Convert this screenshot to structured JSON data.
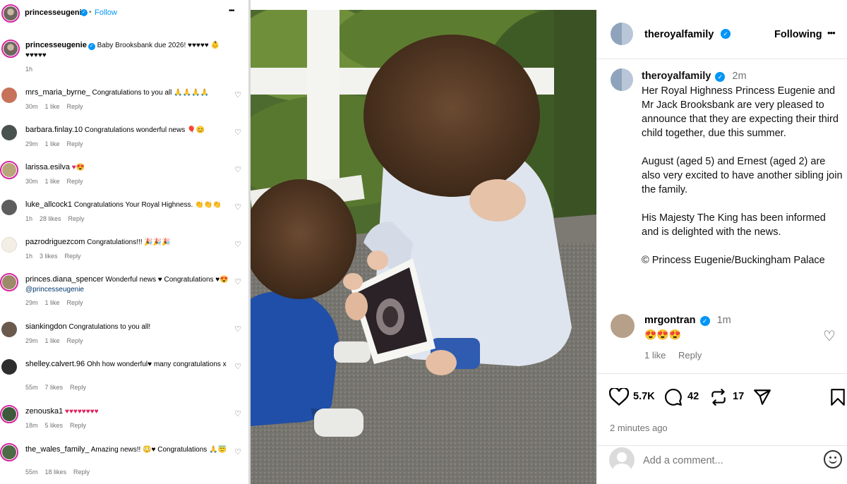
{
  "left_panel": {
    "header": {
      "username": "princesseugenie",
      "separator": "•",
      "follow_label": "Follow",
      "more_label": "•••"
    },
    "post": {
      "username": "princesseugenie",
      "text": "Baby Brooksbank due 2026! ♥♥♥♥♥ 👶♥♥♥♥♥",
      "time": "1h"
    },
    "comments": [
      {
        "username": "mrs_maria_byrne_",
        "text": "Congratulations to you all 🙏🙏🙏🙏",
        "time": "30m",
        "likes": "1 like",
        "reply": "Reply"
      },
      {
        "username": "barbara.finlay.10",
        "text": "Congratulations wonderful news 🎈😊",
        "time": "29m",
        "likes": "1 like",
        "reply": "Reply"
      },
      {
        "username": "larissa.esilva",
        "text": "♥😍",
        "time": "30m",
        "likes": "1 like",
        "reply": "Reply"
      },
      {
        "username": "luke_allcock1",
        "text": "Congratulations Your Royal Highness. 👏👏👏",
        "time": "1h",
        "likes": "28 likes",
        "reply": "Reply"
      },
      {
        "username": "pazrodriguezcom",
        "text": "Congratulations!!! 🎉🎉🎉",
        "time": "1h",
        "likes": "3 likes",
        "reply": "Reply"
      },
      {
        "username": "princes.diana_spencer",
        "text": "Wonderful news ♥ Congratulations ♥😍",
        "mention": "@princesseugenie",
        "time": "29m",
        "likes": "1 like",
        "reply": "Reply"
      },
      {
        "username": "siankingdon",
        "text": "Congratulations to you all!",
        "time": "29m",
        "likes": "1 like",
        "reply": "Reply"
      },
      {
        "username": "shelley.calvert.96",
        "text": "Ohh how wonderful♥ many congratulations x",
        "time": "55m",
        "likes": "7 likes",
        "reply": "Reply"
      },
      {
        "username": "zenouska1",
        "text": "♥♥♥♥♥♥♥♥",
        "time": "18m",
        "likes": "5 likes",
        "reply": "Reply"
      },
      {
        "username": "the_wales_family_",
        "text": "Amazing news!! 😳♥ Congratulations 🙏😇",
        "time": "55m",
        "likes": "18 likes",
        "reply": "Reply"
      }
    ]
  },
  "right_panel": {
    "header": {
      "username": "theroyalfamily",
      "following_label": "Following",
      "more_label": "•••"
    },
    "caption": {
      "username": "theroyalfamily",
      "time": "2m",
      "paragraphs": [
        "Her Royal Highness Princess Eugenie and Mr Jack Brooksbank are very pleased to announce that they are expecting their third child together, due this summer.",
        "August (aged 5) and Ernest (aged 2) are also very excited to have another sibling join the family.",
        "His Majesty The King has been informed and is delighted with the news.",
        "© Princess Eugenie/Buckingham Palace"
      ]
    },
    "top_comment": {
      "username": "mrgontran",
      "time": "1m",
      "text": "😍😍😍",
      "likes": "1 like",
      "reply": "Reply"
    },
    "actions": {
      "likes": "5.7K",
      "comments": "42",
      "reposts": "17",
      "timestamp": "2 minutes ago"
    },
    "add_comment": {
      "placeholder": "Add a comment..."
    }
  },
  "colors": {
    "link_blue": "#0095f6",
    "story_ring": "#d6249f",
    "heart_red": "#e0245e",
    "muted_text": "#737373"
  }
}
